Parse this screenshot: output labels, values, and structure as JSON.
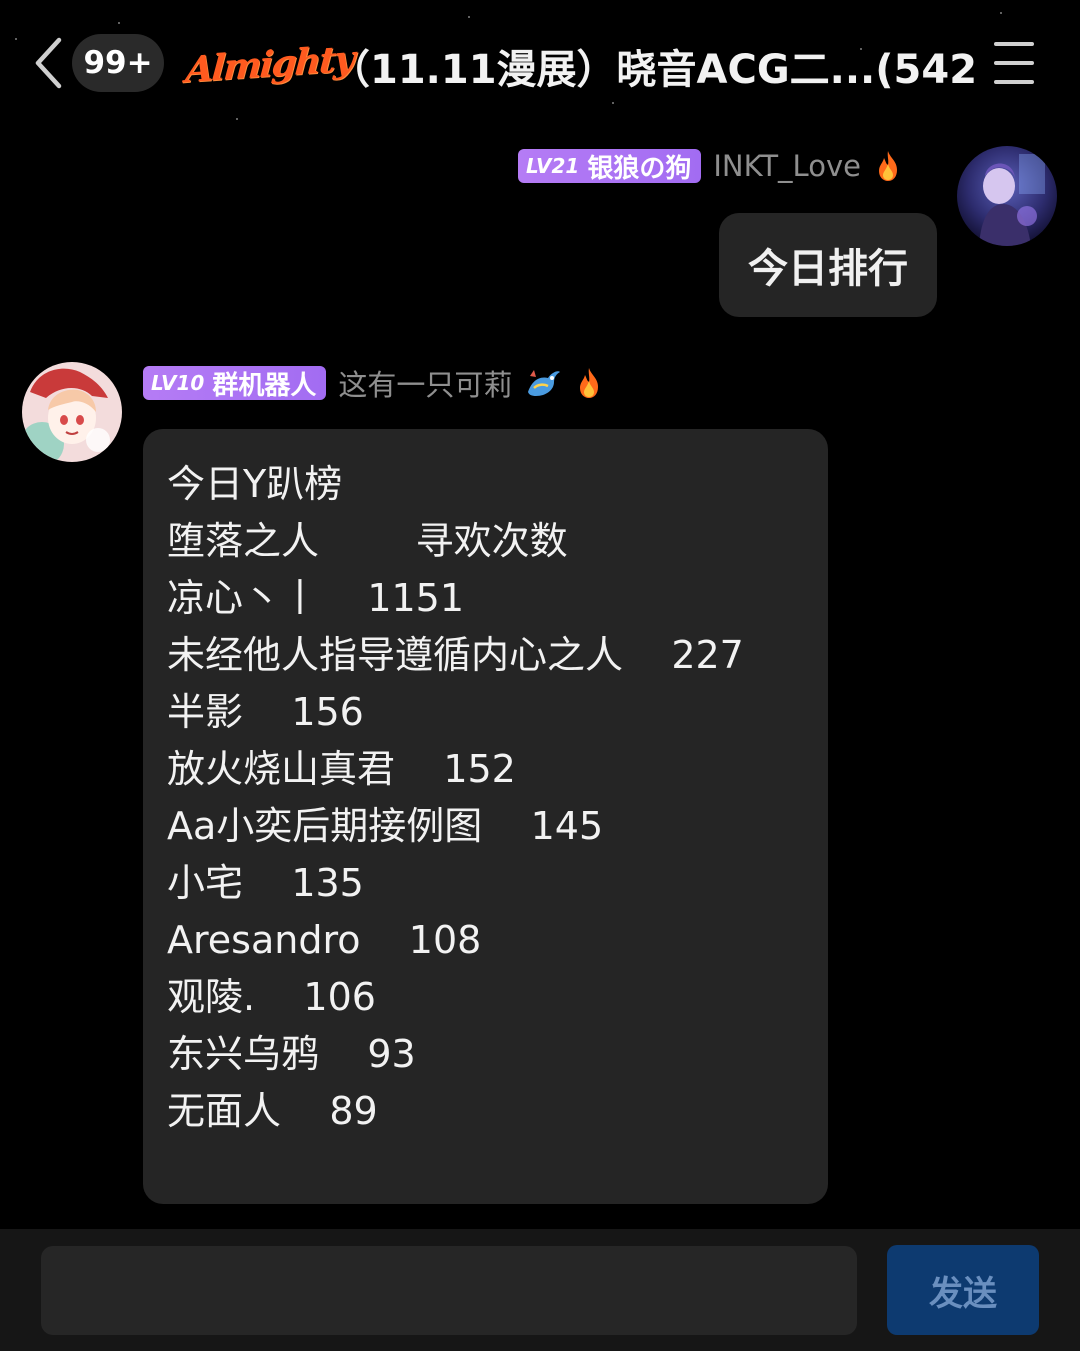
{
  "header": {
    "unread_count": "99+",
    "logo_text": "Almighty",
    "title": "（11.11漫展）晓音ACG二...(542)"
  },
  "messages": [
    {
      "side": "right",
      "level": "LV21",
      "title_tag": "银狼の狗",
      "nickname": "INKT_Love",
      "text": "今日排行"
    },
    {
      "side": "left",
      "level": "LV10",
      "title_tag": "群机器人",
      "nickname": "这有一只可莉",
      "lines": [
        "今日Y趴榜",
        "堕落之人        寻欢次数",
        "凉心丶丨    1151",
        "未经他人指导遵循内心之人    227",
        "半影    156",
        "放火烧山真君    152",
        "Aa小奕后期接例图    145",
        "小宅    135",
        "Aresandro    108",
        "观陵.    106",
        "东兴乌鸦    93",
        "无面人    89"
      ]
    }
  ],
  "input_bar": {
    "placeholder": "",
    "send_label": "发送"
  },
  "colors": {
    "background": "#000000",
    "bubble": "#252525",
    "level_tag": "#a26cf2",
    "logo": "#ff5a1f",
    "send_button": "#0d3a70"
  }
}
